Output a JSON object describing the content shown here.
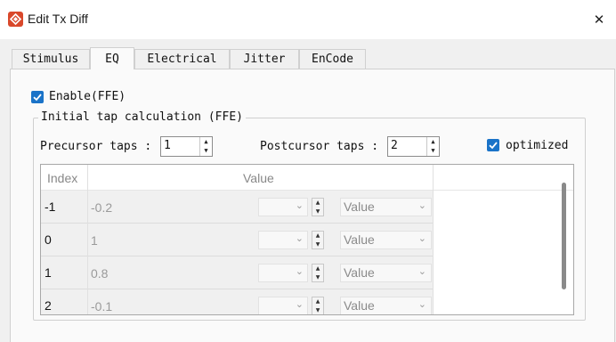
{
  "window": {
    "title": "Edit Tx Diff",
    "close_glyph": "✕",
    "accent": "#d9482b"
  },
  "tabs": [
    {
      "label": "Stimulus",
      "active": false
    },
    {
      "label": "EQ",
      "active": true
    },
    {
      "label": "Electrical",
      "active": false
    },
    {
      "label": "Jitter",
      "active": false
    },
    {
      "label": "EnCode",
      "active": false
    }
  ],
  "eq": {
    "enable_label": "Enable(FFE)",
    "enable_checked": true,
    "group_title": "Initial tap calculation (FFE)",
    "precursor": {
      "label": "Precursor taps :",
      "value": "1"
    },
    "postcursor": {
      "label": "Postcursor taps :",
      "value": "2"
    },
    "optimized_label": "optimized",
    "optimized_checked": true,
    "checkbox_color": "#1a73c8"
  },
  "table": {
    "headers": {
      "index": "Index",
      "value": "Value"
    },
    "rows": [
      {
        "index": "-1",
        "value": "-0.2",
        "unit": "Value"
      },
      {
        "index": "0",
        "value": "1",
        "unit": "Value"
      },
      {
        "index": "1",
        "value": "0.8",
        "unit": "Value"
      },
      {
        "index": "2",
        "value": "-0.1",
        "unit": "Value"
      }
    ]
  }
}
